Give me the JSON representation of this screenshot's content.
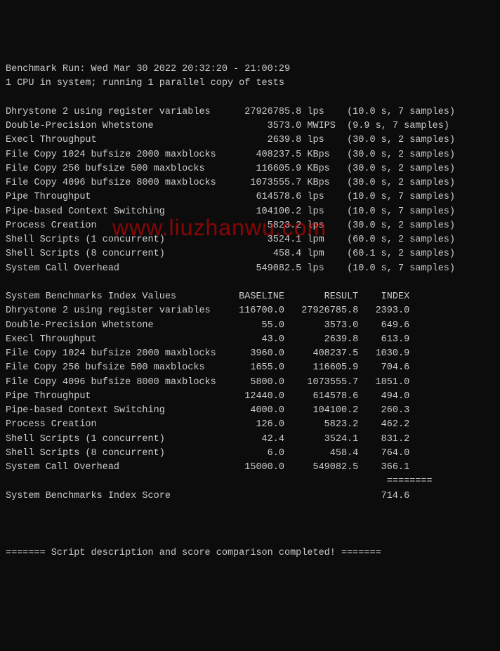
{
  "header": {
    "line1": "Benchmark Run: Wed Mar 30 2022 20:32:20 - 21:00:29",
    "line2": "1 CPU in system; running 1 parallel copy of tests"
  },
  "tests": [
    {
      "name": "Dhrystone 2 using register variables",
      "value": "27926785.8",
      "unit": "lps",
      "timing": "(10.0 s, 7 samples)"
    },
    {
      "name": "Double-Precision Whetstone",
      "value": "3573.0",
      "unit": "MWIPS",
      "timing": "(9.9 s, 7 samples)"
    },
    {
      "name": "Execl Throughput",
      "value": "2639.8",
      "unit": "lps",
      "timing": "(30.0 s, 2 samples)"
    },
    {
      "name": "File Copy 1024 bufsize 2000 maxblocks",
      "value": "408237.5",
      "unit": "KBps",
      "timing": "(30.0 s, 2 samples)"
    },
    {
      "name": "File Copy 256 bufsize 500 maxblocks",
      "value": "116605.9",
      "unit": "KBps",
      "timing": "(30.0 s, 2 samples)"
    },
    {
      "name": "File Copy 4096 bufsize 8000 maxblocks",
      "value": "1073555.7",
      "unit": "KBps",
      "timing": "(30.0 s, 2 samples)"
    },
    {
      "name": "Pipe Throughput",
      "value": "614578.6",
      "unit": "lps",
      "timing": "(10.0 s, 7 samples)"
    },
    {
      "name": "Pipe-based Context Switching",
      "value": "104100.2",
      "unit": "lps",
      "timing": "(10.0 s, 7 samples)"
    },
    {
      "name": "Process Creation",
      "value": "5823.2",
      "unit": "lps",
      "timing": "(30.0 s, 2 samples)"
    },
    {
      "name": "Shell Scripts (1 concurrent)",
      "value": "3524.1",
      "unit": "lpm",
      "timing": "(60.0 s, 2 samples)"
    },
    {
      "name": "Shell Scripts (8 concurrent)",
      "value": "458.4",
      "unit": "lpm",
      "timing": "(60.1 s, 2 samples)"
    },
    {
      "name": "System Call Overhead",
      "value": "549082.5",
      "unit": "lps",
      "timing": "(10.0 s, 7 samples)"
    }
  ],
  "index_header": {
    "title": "System Benchmarks Index Values",
    "col_baseline": "BASELINE",
    "col_result": "RESULT",
    "col_index": "INDEX"
  },
  "index": [
    {
      "name": "Dhrystone 2 using register variables",
      "baseline": "116700.0",
      "result": "27926785.8",
      "idx": "2393.0"
    },
    {
      "name": "Double-Precision Whetstone",
      "baseline": "55.0",
      "result": "3573.0",
      "idx": "649.6"
    },
    {
      "name": "Execl Throughput",
      "baseline": "43.0",
      "result": "2639.8",
      "idx": "613.9"
    },
    {
      "name": "File Copy 1024 bufsize 2000 maxblocks",
      "baseline": "3960.0",
      "result": "408237.5",
      "idx": "1030.9"
    },
    {
      "name": "File Copy 256 bufsize 500 maxblocks",
      "baseline": "1655.0",
      "result": "116605.9",
      "idx": "704.6"
    },
    {
      "name": "File Copy 4096 bufsize 8000 maxblocks",
      "baseline": "5800.0",
      "result": "1073555.7",
      "idx": "1851.0"
    },
    {
      "name": "Pipe Throughput",
      "baseline": "12440.0",
      "result": "614578.6",
      "idx": "494.0"
    },
    {
      "name": "Pipe-based Context Switching",
      "baseline": "4000.0",
      "result": "104100.2",
      "idx": "260.3"
    },
    {
      "name": "Process Creation",
      "baseline": "126.0",
      "result": "5823.2",
      "idx": "462.2"
    },
    {
      "name": "Shell Scripts (1 concurrent)",
      "baseline": "42.4",
      "result": "3524.1",
      "idx": "831.2"
    },
    {
      "name": "Shell Scripts (8 concurrent)",
      "baseline": "6.0",
      "result": "458.4",
      "idx": "764.0"
    },
    {
      "name": "System Call Overhead",
      "baseline": "15000.0",
      "result": "549082.5",
      "idx": "366.1"
    }
  ],
  "score": {
    "sep": "                                                                   ========",
    "label": "System Benchmarks Index Score",
    "value": "714.6"
  },
  "footer": "======= Script description and score comparison completed! =======",
  "watermark": "www.liuzhanwu.com"
}
